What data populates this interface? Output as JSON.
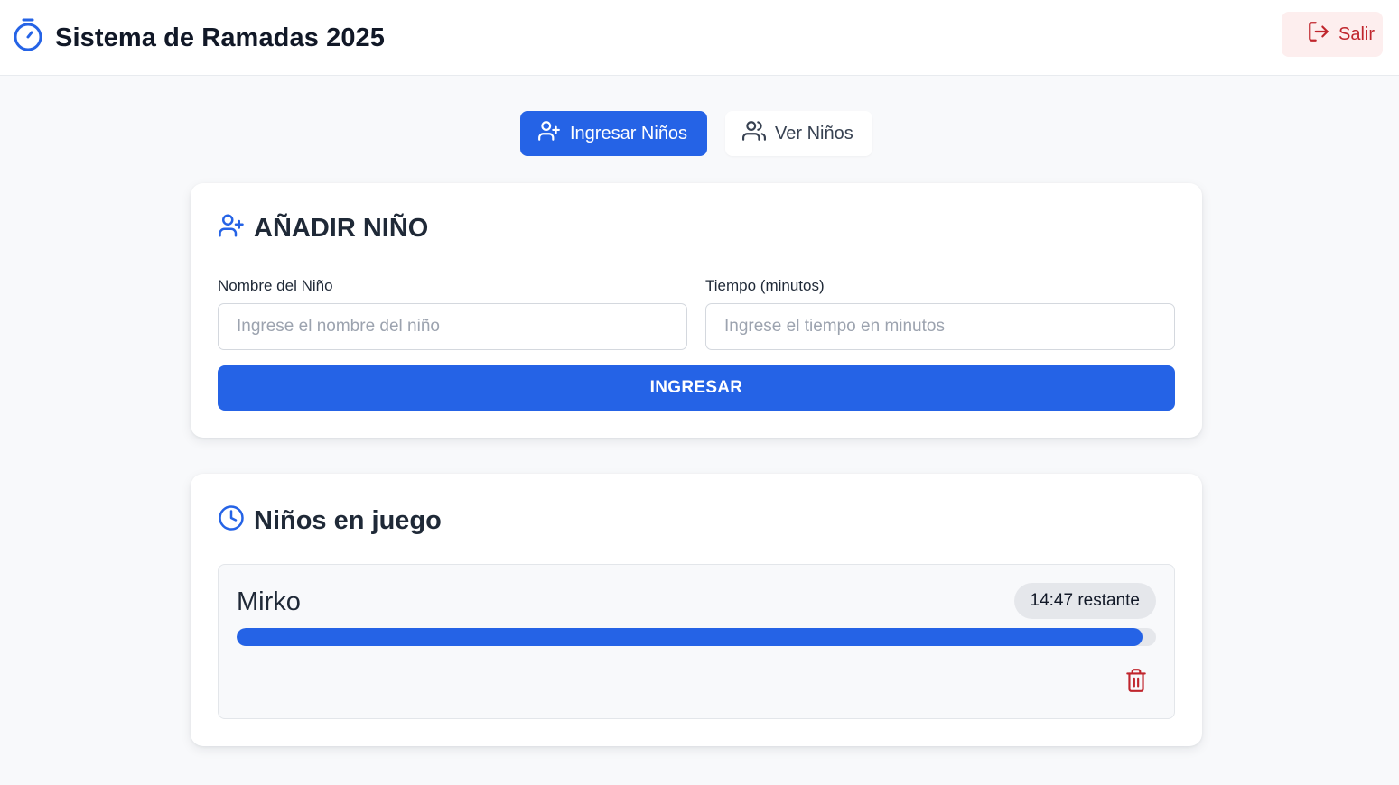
{
  "header": {
    "title": "Sistema de Ramadas 2025",
    "logo_icon": "stopwatch-icon",
    "logout_label": "Salir",
    "logout_icon": "log-out-icon"
  },
  "tabs": [
    {
      "label": "Ingresar Niños",
      "icon": "user-plus-icon",
      "active": true
    },
    {
      "label": "Ver Niños",
      "icon": "users-icon",
      "active": false
    }
  ],
  "add_form": {
    "title": "AÑADIR NIÑO",
    "icon": "user-plus-icon",
    "name_label": "Nombre del Niño",
    "name_placeholder": "Ingrese el nombre del niño",
    "name_value": "",
    "time_label": "Tiempo (minutos)",
    "time_placeholder": "Ingrese el tiempo en minutos",
    "time_value": "",
    "submit_label": "INGRESAR"
  },
  "playing": {
    "title": "Niños en juego",
    "icon": "clock-icon",
    "kids": [
      {
        "name": "Mirko",
        "time_left": "14:47 restante",
        "progress_fraction": 0.985,
        "delete_icon": "trash-icon"
      }
    ]
  },
  "colors": {
    "primary": "#2563e6",
    "danger": "#c0262d",
    "danger_bg": "#fdeeee",
    "background": "#f8f9fb"
  }
}
